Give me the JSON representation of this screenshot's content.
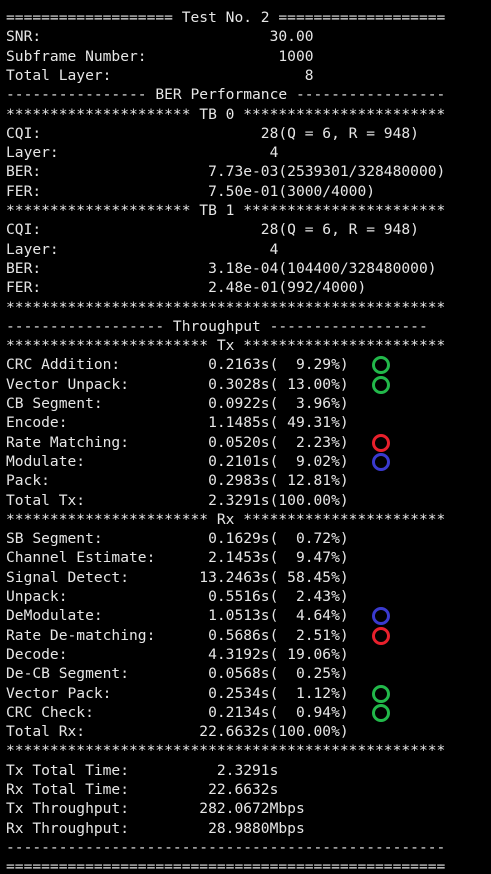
{
  "terminal": {
    "lines": [
      "=================== Test No. 2 ===================",
      "SNR:                          30.00",
      "Subframe Number:               1000",
      "Total Layer:                      8",
      "---------------- BER Performance -----------------",
      "********************* TB 0 ***********************",
      "CQI:                         28(Q = 6, R = 948)",
      "Layer:                        4",
      "BER:                   7.73e-03(2539301/328480000)",
      "FER:                   7.50e-01(3000/4000)",
      "********************* TB 1 ***********************",
      "CQI:                         28(Q = 6, R = 948)",
      "Layer:                        4",
      "BER:                   3.18e-04(104400/328480000)",
      "FER:                   2.48e-01(992/4000)",
      "**************************************************",
      "------------------ Throughput ------------------",
      "*********************** Tx ***********************",
      "CRC Addition:          0.2163s(  9.29%)",
      "Vector Unpack:         0.3028s( 13.00%)",
      "CB Segment:            0.0922s(  3.96%)",
      "Encode:                1.1485s( 49.31%)",
      "Rate Matching:         0.0520s(  2.23%)",
      "Modulate:              0.2101s(  9.02%)",
      "Pack:                  0.2983s( 12.81%)",
      "Total Tx:              2.3291s(100.00%)",
      "*********************** Rx ***********************",
      "SB Segment:            0.1629s(  0.72%)",
      "Channel Estimate:      2.1453s(  9.47%)",
      "Signal Detect:        13.2463s( 58.45%)",
      "Unpack:                0.5516s(  2.43%)",
      "DeModulate:            1.0513s(  4.64%)",
      "Rate De-matching:      0.5686s(  2.51%)",
      "Decode:                4.3192s( 19.06%)",
      "De-CB Segment:         0.0568s(  0.25%)",
      "Vector Pack:           0.2534s(  1.12%)",
      "CRC Check:             0.2134s(  0.94%)",
      "Total Rx:             22.6632s(100.00%)",
      "**************************************************",
      "Tx Total Time:          2.3291s",
      "Rx Total Time:         22.6632s",
      "Tx Throughput:        282.0672Mbps",
      "Rx Throughput:         28.9880Mbps",
      "--------------------------------------------------",
      "=================================================="
    ]
  },
  "markers": [
    {
      "color": "#22b84a",
      "line": 18
    },
    {
      "color": "#22b84a",
      "line": 19
    },
    {
      "color": "#e8202c",
      "line": 22
    },
    {
      "color": "#3a3acf",
      "line": 23
    },
    {
      "color": "#3a3acf",
      "line": 31
    },
    {
      "color": "#e8202c",
      "line": 32
    },
    {
      "color": "#22b84a",
      "line": 35
    },
    {
      "color": "#22b84a",
      "line": 36
    }
  ]
}
